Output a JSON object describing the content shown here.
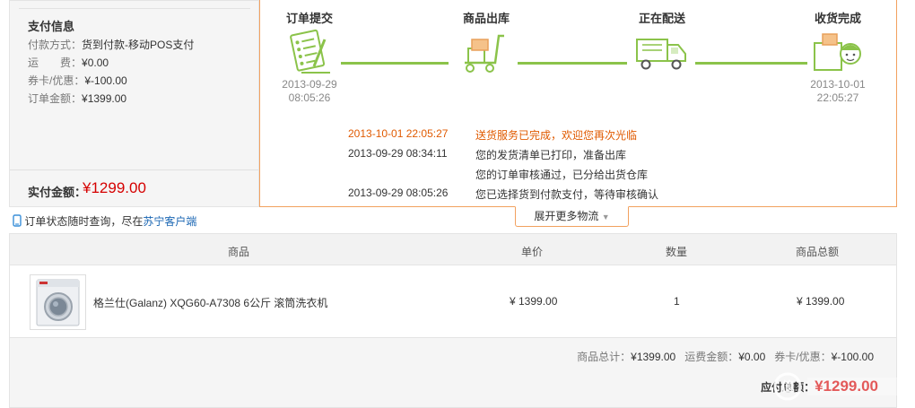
{
  "payment": {
    "title": "支付信息",
    "method_label": "付款方式：",
    "method_value": "货到付款-移动POS支付",
    "shipping_label": "运　　费：",
    "shipping_value": "¥0.00",
    "coupon_label": "券卡/优惠：",
    "coupon_value": "¥-100.00",
    "order_amount_label": "订单金额：",
    "order_amount_value": "¥1399.00",
    "paid_label": "实付金额：",
    "paid_value": "¥1299.00"
  },
  "logistics": {
    "steps": [
      {
        "title": "订单提交",
        "date": "2013-09-29",
        "time": "08:05:26",
        "icon": "order-form-icon"
      },
      {
        "title": "商品出库",
        "date": "",
        "time": "",
        "icon": "warehouse-cart-icon"
      },
      {
        "title": "正在配送",
        "date": "",
        "time": "",
        "icon": "delivery-truck-icon"
      },
      {
        "title": "收货完成",
        "date": "2013-10-01",
        "time": "22:05:27",
        "icon": "package-received-icon"
      }
    ],
    "events": [
      {
        "time": "2013-10-01 22:05:27",
        "message": "送货服务已完成，欢迎您再次光临"
      },
      {
        "time": "2013-09-29 08:34:11",
        "message": "您的发货清单已打印，准备出库"
      },
      {
        "time": "",
        "message": "您的订单审核通过，已分给出货仓库"
      },
      {
        "time": "2013-09-29 08:05:26",
        "message": "您已选择货到付款支付，等待审核确认"
      }
    ],
    "more_label": "展开更多物流",
    "accent": "#f2a15f",
    "progress_color": "#8bc34a"
  },
  "query": {
    "text": "订单状态随时查询，尽在",
    "link": "苏宁客户端"
  },
  "table": {
    "headers": [
      "商品",
      "单价",
      "数量",
      "商品总额"
    ],
    "rows": [
      {
        "name": "格兰仕(Galanz) XQG60-A7308 6公斤 滚筒洗衣机",
        "price": "¥ 1399.00",
        "qty": "1",
        "total": "¥ 1399.00"
      }
    ]
  },
  "summary": {
    "goods_total_label": "商品总计：",
    "goods_total_value": "¥1399.00",
    "freight_label": "运费金额：",
    "freight_value": "¥0.00",
    "coupon_label": "券卡/优惠：",
    "coupon_value": "¥-100.00",
    "due_label": "应付总额：",
    "due_value": "¥1299.00"
  },
  "colors": {
    "price_red": "#d50000",
    "event_highlight": "#e05a00",
    "link_blue": "#1a66b3"
  }
}
